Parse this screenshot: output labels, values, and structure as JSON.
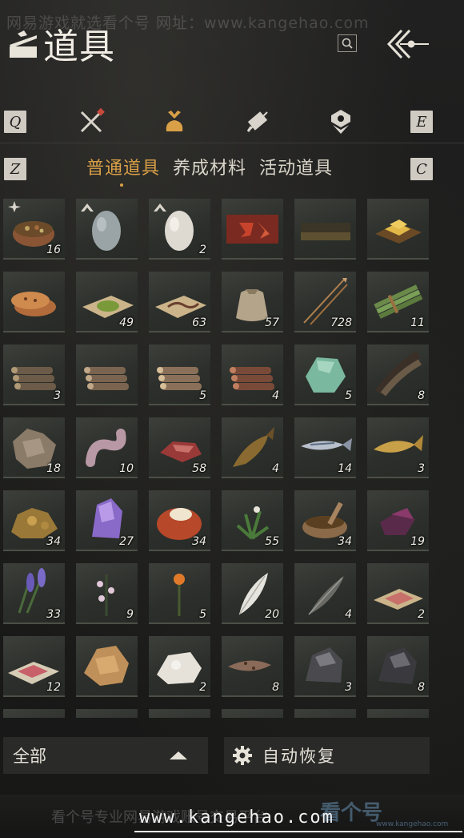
{
  "watermark_top": "网易游戏就选看个号   网址：www.kangehao.com",
  "header": {
    "title": "道具"
  },
  "tabs": {
    "left_key": "Q",
    "right_key": "E",
    "sub_left_key": "Z",
    "sub_right_key": "C"
  },
  "subtabs": [
    {
      "label": "普通道具",
      "active": true
    },
    {
      "label": "养成材料",
      "active": false
    },
    {
      "label": "活动道具",
      "active": false
    }
  ],
  "items": [
    {
      "icon": "stew-bowl-icon",
      "count": "16"
    },
    {
      "icon": "gray-egg-icon",
      "count": ""
    },
    {
      "icon": "white-egg-icon",
      "count": "2"
    },
    {
      "icon": "maple-leaf-box-icon",
      "count": ""
    },
    {
      "icon": "dark-scroll-icon",
      "count": ""
    },
    {
      "icon": "gold-tray-icon",
      "count": ""
    },
    {
      "icon": "flatbread-icon",
      "count": ""
    },
    {
      "icon": "herb-powder-icon",
      "count": "49"
    },
    {
      "icon": "worm-paper-icon",
      "count": "63"
    },
    {
      "icon": "cloth-sack-icon",
      "count": "57"
    },
    {
      "icon": "arrows-icon",
      "count": "728"
    },
    {
      "icon": "bamboo-bundle-icon",
      "count": "11"
    },
    {
      "icon": "log-pile-dark-icon",
      "count": "3"
    },
    {
      "icon": "log-pile-icon",
      "count": ""
    },
    {
      "icon": "log-pile-light-icon",
      "count": "5"
    },
    {
      "icon": "log-pile-red-icon",
      "count": "4"
    },
    {
      "icon": "jade-stone-icon",
      "count": "5"
    },
    {
      "icon": "feathers-icon",
      "count": "8"
    },
    {
      "icon": "hide-pelt-icon",
      "count": "18"
    },
    {
      "icon": "intestine-icon",
      "count": "10"
    },
    {
      "icon": "raw-meat-icon",
      "count": "58"
    },
    {
      "icon": "brown-fish-icon",
      "count": "4"
    },
    {
      "icon": "silver-fish-icon",
      "count": "14"
    },
    {
      "icon": "golden-carp-icon",
      "count": "3"
    },
    {
      "icon": "ore-lump-icon",
      "count": "34"
    },
    {
      "icon": "amethyst-icon",
      "count": "27"
    },
    {
      "icon": "red-bean-icon",
      "count": "34"
    },
    {
      "icon": "herb-plant-icon",
      "count": "55"
    },
    {
      "icon": "spice-mortar-icon",
      "count": "34"
    },
    {
      "icon": "purple-herb-icon",
      "count": "19"
    },
    {
      "icon": "lavender-icon",
      "count": "33"
    },
    {
      "icon": "blossom-branch-icon",
      "count": "9"
    },
    {
      "icon": "orange-flower-icon",
      "count": "5"
    },
    {
      "icon": "white-feather-icon",
      "count": "20"
    },
    {
      "icon": "gray-feather-icon",
      "count": "4"
    },
    {
      "icon": "sliced-meat-icon",
      "count": "2"
    },
    {
      "icon": "meat-cloth-icon",
      "count": "12"
    },
    {
      "icon": "tan-fur-icon",
      "count": ""
    },
    {
      "icon": "white-fur-icon",
      "count": "2"
    },
    {
      "icon": "spotted-fish-icon",
      "count": "8"
    },
    {
      "icon": "dark-ore-icon",
      "count": "3"
    },
    {
      "icon": "black-ore-icon",
      "count": "8"
    }
  ],
  "bottom": {
    "filter_label": "全部",
    "auto_label": "自动恢复"
  },
  "watermark_bottom": "看个号专业网易游戏账号交易平台",
  "watermark_url": "www.kangehao.com",
  "watermark_logo": "看个号",
  "watermark_logo_sub": "www.kangehao.com"
}
